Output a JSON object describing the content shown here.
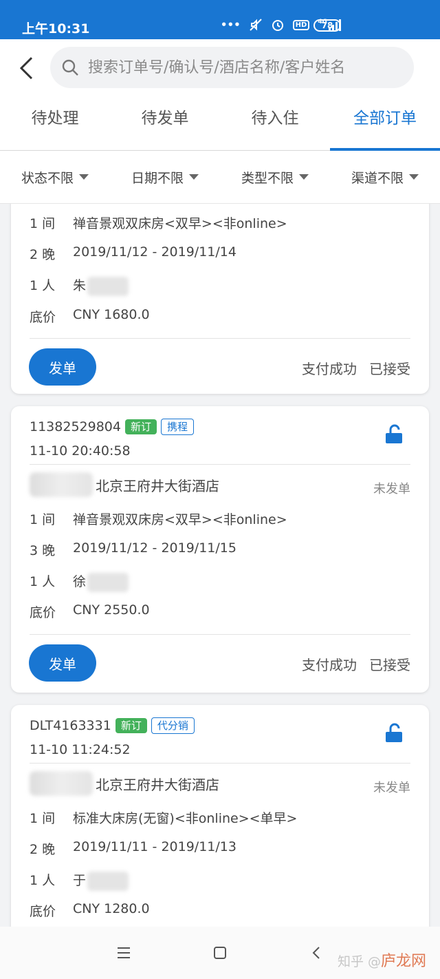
{
  "status_bar": {
    "time": "上午10:31",
    "icons_text": "HD",
    "network": "4G",
    "battery": "78"
  },
  "header": {
    "search_placeholder": "搜索订单号/确认号/酒店名称/客户姓名"
  },
  "tabs": [
    {
      "label": "待处理",
      "active": false
    },
    {
      "label": "待发单",
      "active": false
    },
    {
      "label": "待入住",
      "active": false
    },
    {
      "label": "全部订单",
      "active": true
    }
  ],
  "filters": [
    "状态不限",
    "日期不限",
    "类型不限",
    "渠道不限"
  ],
  "cards": [
    {
      "room": {
        "k": "1 间",
        "v": "禅音景观双床房<双早><非online>"
      },
      "nights": {
        "k": "2 晚",
        "v": "2019/11/12 - 2019/11/14"
      },
      "guests": {
        "k": "1 人",
        "v": "朱"
      },
      "price": {
        "k": "底价",
        "v": "CNY 1680.0"
      },
      "send_label": "发单",
      "pay_status": "支付成功",
      "accept_status": "已接受"
    },
    {
      "order_no": "11382529804",
      "badge_new": "新订",
      "badge_channel": "携程",
      "time": "11-10 20:40:58",
      "hotel": "北京王府井大街酒店",
      "hotel_status": "未发单",
      "room": {
        "k": "1 间",
        "v": "禅音景观双床房<双早><非online>"
      },
      "nights": {
        "k": "3 晚",
        "v": "2019/11/12 - 2019/11/15"
      },
      "guests": {
        "k": "1 人",
        "v": "徐"
      },
      "price": {
        "k": "底价",
        "v": "CNY 2550.0"
      },
      "send_label": "发单",
      "pay_status": "支付成功",
      "accept_status": "已接受"
    },
    {
      "order_no": "DLT4163331",
      "badge_new": "新订",
      "badge_channel": "代分销",
      "time": "11-10 11:24:52",
      "hotel": "北京王府井大街酒店",
      "hotel_status": "未发单",
      "room": {
        "k": "1 间",
        "v": "标准大床房(无窗)<非online><单早>"
      },
      "nights": {
        "k": "2 晚",
        "v": "2019/11/11 - 2019/11/13"
      },
      "guests": {
        "k": "1 人",
        "v": "于"
      },
      "price": {
        "k": "底价",
        "v": "CNY 1280.0"
      }
    }
  ],
  "watermark": {
    "a": "知乎 @",
    "b": "庐龙网"
  },
  "colors": {
    "primary": "#1976d2",
    "badge_green": "#43b15a"
  }
}
